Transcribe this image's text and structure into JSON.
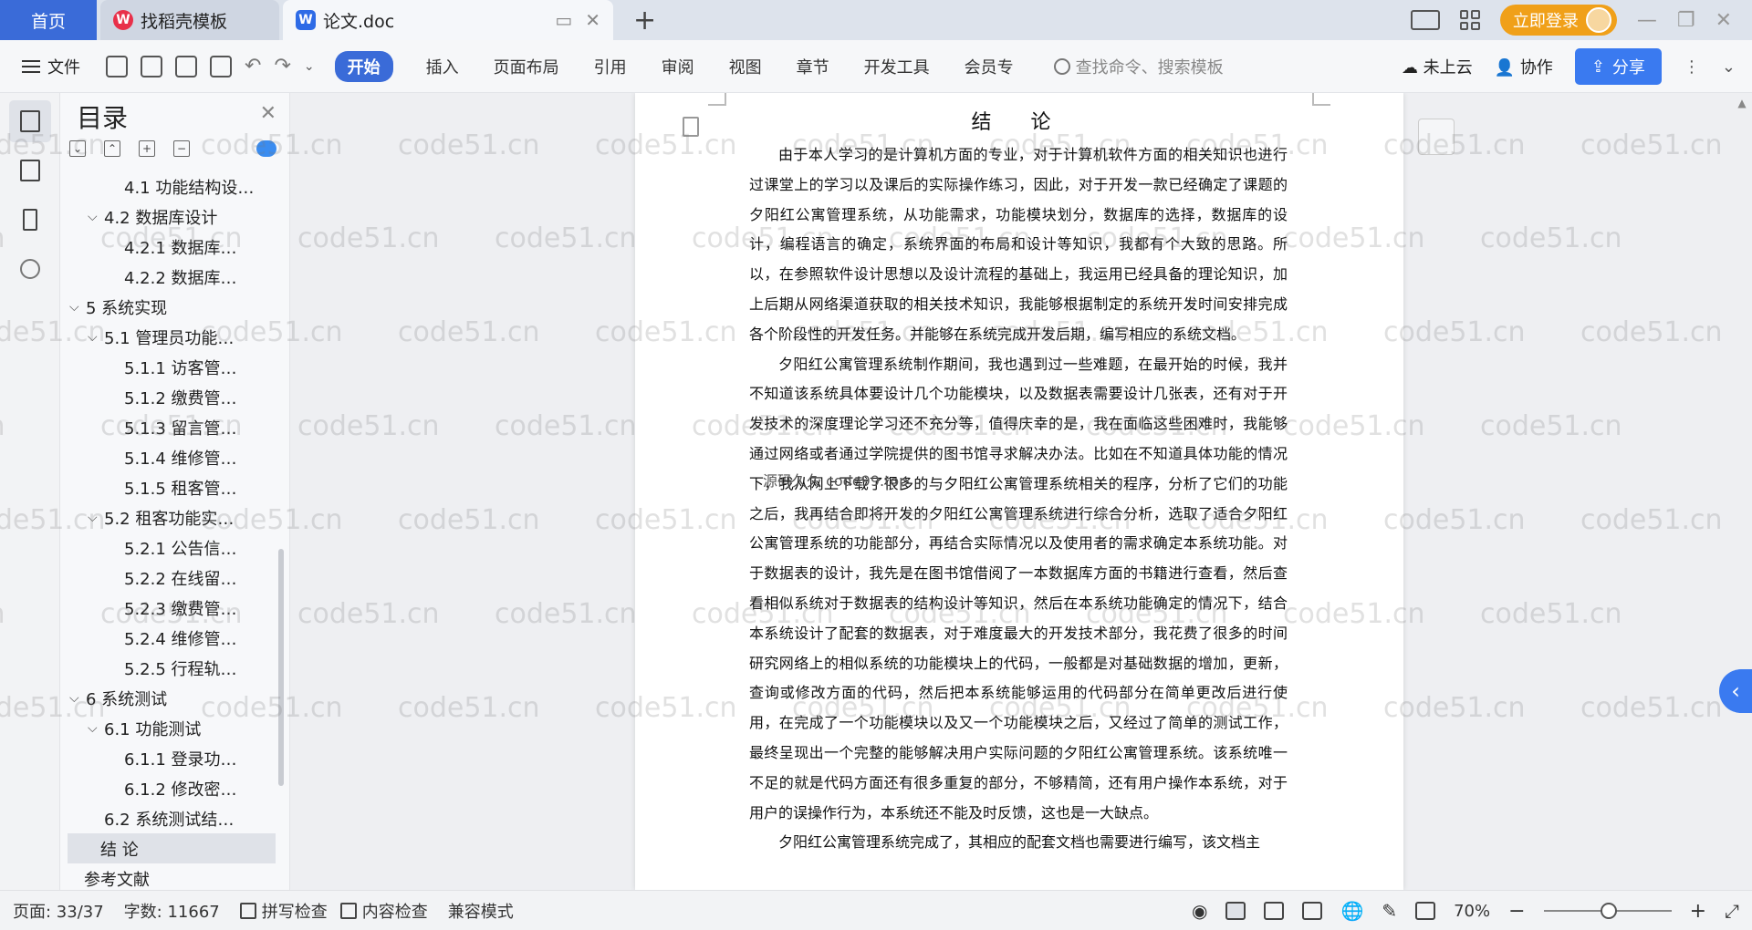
{
  "titlebar": {
    "tabs": [
      {
        "label": "首页"
      },
      {
        "label": "找稻壳模板"
      },
      {
        "label": "论文.doc"
      }
    ],
    "login_label": "立即登录"
  },
  "menubar": {
    "file_label": "文件",
    "items": [
      "开始",
      "插入",
      "页面布局",
      "引用",
      "审阅",
      "视图",
      "章节",
      "开发工具",
      "会员专"
    ],
    "active_index": 0,
    "search_placeholder": "查找命令、搜索模板",
    "cloud_label": "未上云",
    "collab_label": "协作",
    "share_label": "分享"
  },
  "toc": {
    "title": "目录",
    "items": [
      {
        "label": "4.1  功能结构设…",
        "level": 3,
        "caret": ""
      },
      {
        "label": "4.2  数据库设计",
        "level": 2,
        "caret": "v"
      },
      {
        "label": "4.2.1  数据库…",
        "level": 3,
        "caret": ""
      },
      {
        "label": "4.2.2  数据库…",
        "level": 3,
        "caret": ""
      },
      {
        "label": "5  系统实现",
        "level": 1,
        "caret": "v"
      },
      {
        "label": "5.1  管理员功能…",
        "level": 2,
        "caret": "v"
      },
      {
        "label": "5.1.1  访客管…",
        "level": 3,
        "caret": ""
      },
      {
        "label": "5.1.2  缴费管…",
        "level": 3,
        "caret": ""
      },
      {
        "label": "5.1.3  留言管…",
        "level": 3,
        "caret": ""
      },
      {
        "label": "5.1.4  维修管…",
        "level": 3,
        "caret": ""
      },
      {
        "label": "5.1.5  租客管…",
        "level": 3,
        "caret": ""
      },
      {
        "label": "5.2  租客功能实…",
        "level": 2,
        "caret": "v"
      },
      {
        "label": "5.2.1  公告信…",
        "level": 3,
        "caret": ""
      },
      {
        "label": "5.2.2  在线留…",
        "level": 3,
        "caret": ""
      },
      {
        "label": "5.2.3  缴费管…",
        "level": 3,
        "caret": ""
      },
      {
        "label": "5.2.4  维修管…",
        "level": 3,
        "caret": ""
      },
      {
        "label": "5.2.5  行程轨…",
        "level": 3,
        "caret": ""
      },
      {
        "label": "6  系统测试",
        "level": 1,
        "caret": "v"
      },
      {
        "label": "6.1  功能测试",
        "level": 2,
        "caret": "v"
      },
      {
        "label": "6.1.1  登录功…",
        "level": 3,
        "caret": ""
      },
      {
        "label": "6.1.2  修改密…",
        "level": 3,
        "caret": ""
      },
      {
        "label": "6.2  系统测试结…",
        "level": 2,
        "caret": ""
      },
      {
        "label": "结  论",
        "level": 1,
        "caret": "",
        "selected": true
      },
      {
        "label": "参考文献",
        "level": 0,
        "caret": ""
      }
    ]
  },
  "document": {
    "heading": "结 论",
    "paragraphs": [
      "由于本人学习的是计算机方面的专业，对于计算机软件方面的相关知识也进行过课堂上的学习以及课后的实际操作练习，因此，对于开发一款已经确定了课题的夕阳红公寓管理系统，从功能需求，功能模块划分，数据库的选择，数据库的设计，编程语言的确定，系统界面的布局和设计等知识，我都有个大致的思路。所以，在参照软件设计思想以及设计流程的基础上，我运用已经具备的理论知识，加上后期从网络渠道获取的相关技术知识，我能够根据制定的系统开发时间安排完成各个阶段性的开发任务。并能够在系统完成开发后期，编写相应的系统文档。",
      "夕阳红公寓管理系统制作期间，我也遇到过一些难题，在最开始的时候，我并不知道该系统具体要设计几个功能模块，以及数据表需要设计几张表，还有对于开发技术的深度理论学习还不充分等，值得庆幸的是，我在面临这些困难时，我能够通过网络或者通过学院提供的图书馆寻求解决办法。比如在不知道具体功能的情况下，我从网上下载了很多的与夕阳红公寓管理系统相关的程序，分析了它们的功能之后，我再结合即将开发的夕阳红公寓管理系统进行综合分析，选取了适合夕阳红公寓管理系统的功能部分，再结合实际情况以及使用者的需求确定本系统功能。对于数据表的设计，我先是在图书馆借阅了一本数据库方面的书籍进行查看，然后查看相似系统对于数据表的结构设计等知识，然后在本系统功能确定的情况下，结合本系统设计了配套的数据表，对于难度最大的开发技术部分，我花费了很多的时间研究网络上的相似系统的功能模块上的代码，一般都是对基础数据的增加，更新，查询或修改方面的代码，然后把本系统能够运用的代码部分在简单更改后进行使用，在完成了一个功能模块以及又一个功能模块之后，又经过了简单的测试工作，最终呈现出一个完整的能够解决用户实际问题的夕阳红公寓管理系统。该系统唯一不足的就是代码方面还有很多重复的部分，不够精简，还有用户操作本系统，对于用户的误操作行为，本系统还不能及时反馈，这也是一大缺点。",
      "夕阳红公寓管理系统完成了，其相应的配套文档也需要进行编写，该文档主"
    ],
    "caption": "源码久久 code99.top",
    "watermark": "code51.cn"
  },
  "statusbar": {
    "page": "页面: 33/37",
    "words": "字数: 11667",
    "spell": "拼写检查",
    "content_check": "内容检查",
    "compat": "兼容模式",
    "zoom": "70%"
  }
}
